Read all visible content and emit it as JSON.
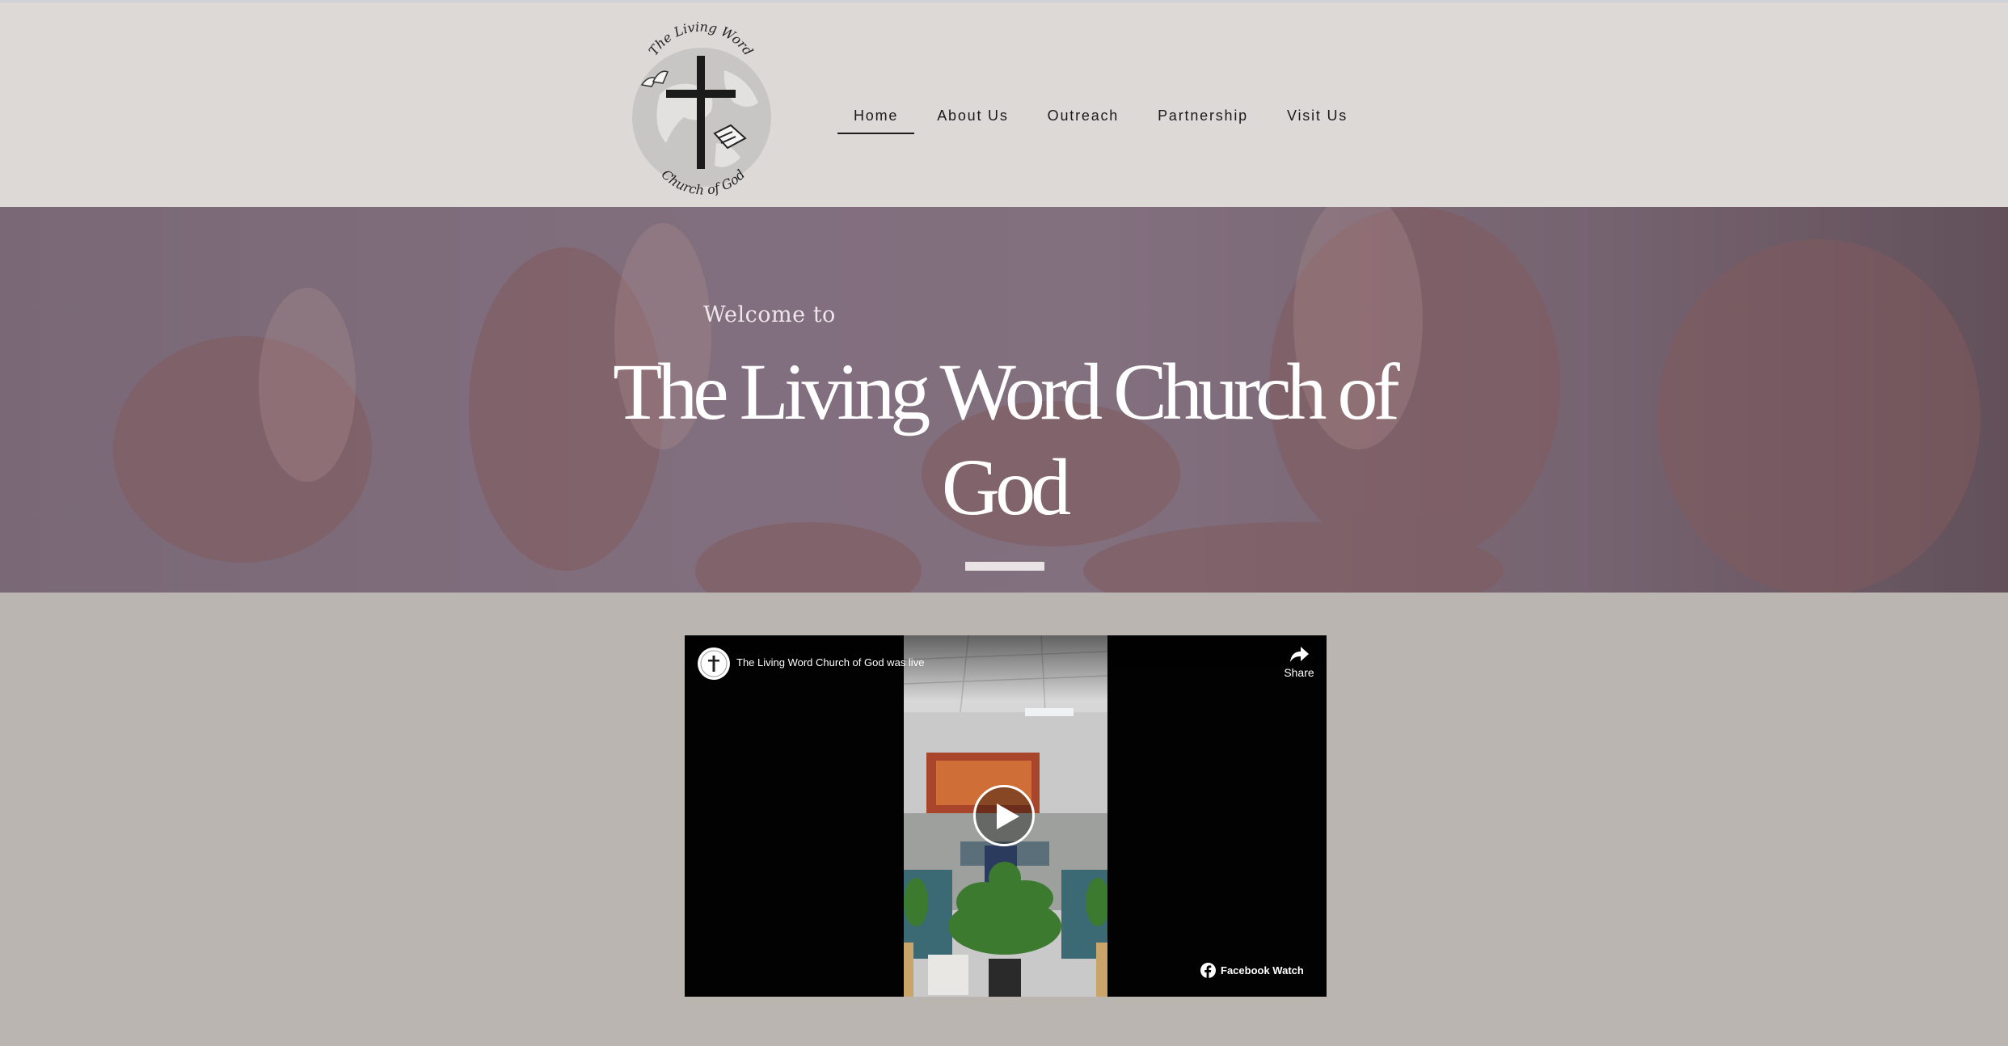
{
  "header": {
    "logo": {
      "top_text": "The Living Word",
      "bottom_text": "Church of God"
    },
    "nav": [
      {
        "label": "Home",
        "active": true
      },
      {
        "label": "About Us",
        "active": false
      },
      {
        "label": "Outreach",
        "active": false
      },
      {
        "label": "Partnership",
        "active": false
      },
      {
        "label": "Visit Us",
        "active": false
      }
    ]
  },
  "hero": {
    "welcome": "Welcome to",
    "title": "The Living Word Church of God"
  },
  "video": {
    "caption": "The Living Word Church of God was live",
    "share_label": "Share",
    "watch_label": "Facebook Watch"
  },
  "colors": {
    "header_bg": "#dcd9d6",
    "page_bg": "#bab5b1",
    "hero_overlay": "#8a7886",
    "video_bg": "#020202",
    "text_dark": "#1a1a1a"
  },
  "icons": [
    "cross-icon",
    "doves-icon",
    "bible-icon",
    "share-icon",
    "play-icon",
    "facebook-icon"
  ]
}
